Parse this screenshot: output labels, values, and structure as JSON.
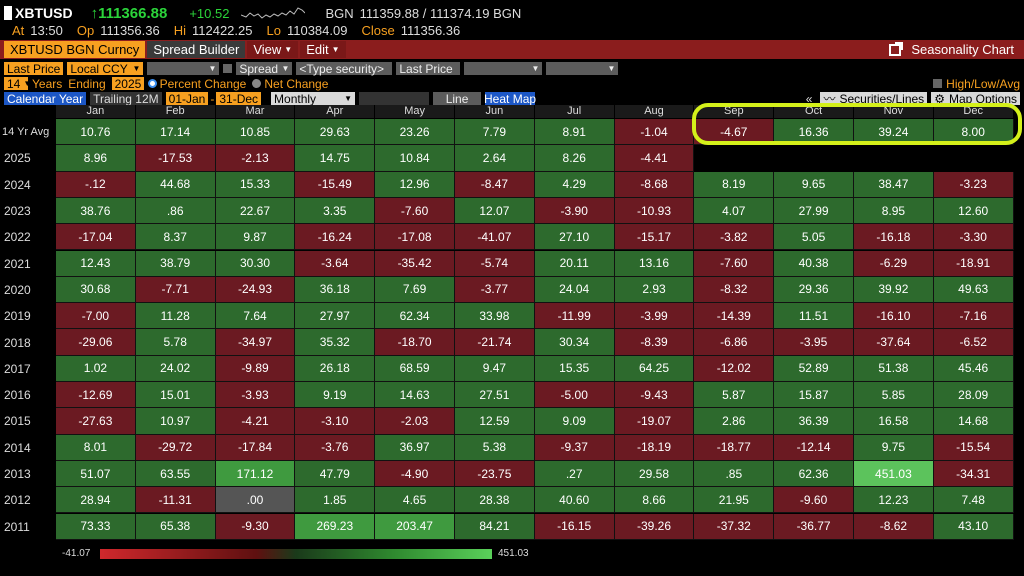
{
  "ticker": {
    "symbol": "XBTUSD",
    "last": "↑111366.88",
    "change": "+10.52",
    "bgn_label": "BGN",
    "bgn_value": "111359.88 / 111374.19 BGN",
    "at_label": "At",
    "at_value": "13:50",
    "op_label": "Op",
    "op_value": "111356.36",
    "hi_label": "Hi",
    "hi_value": "112422.25",
    "lo_label": "Lo",
    "lo_value": "110384.09",
    "close_label": "Close",
    "close_value": "111356.36"
  },
  "menubar": {
    "security": "XBTUSD BGN Curncy",
    "spread_builder": "Spread Builder",
    "view": "View",
    "edit": "Edit",
    "right_title": "Seasonality Chart"
  },
  "controls": {
    "field": "Last Price",
    "currency": "Local CCY",
    "spread": "Spread",
    "type_security_placeholder": "<Type security>",
    "field2": "Last Price",
    "years": "14",
    "years_label": "Years",
    "ending_label": "Ending",
    "ending_year": "2025",
    "percent_change": "Percent Change",
    "net_change": "Net Change",
    "high_low_avg": "High/Low/Avg",
    "calendar_year": "Calendar Year",
    "trailing": "Trailing 12M",
    "from_date": "01-Jan",
    "dash": "-",
    "to_date": "31-Dec",
    "periodicity": "Monthly",
    "line": "Line",
    "heat_map": "Heat Map",
    "collapse": "«",
    "securities_lines": "Securities/Lines",
    "map_options": "Map Options"
  },
  "table": {
    "months": [
      "Jan",
      "Feb",
      "Mar",
      "Apr",
      "May",
      "Jun",
      "Jul",
      "Aug",
      "Sep",
      "Oct",
      "Nov",
      "Dec"
    ],
    "rows": [
      {
        "label": "14 Yr Avg",
        "values": [
          "10.76",
          "17.14",
          "10.85",
          "29.63",
          "23.26",
          "7.79",
          "8.91",
          "-1.04",
          "-4.67",
          "16.36",
          "39.24",
          "8.00"
        ]
      },
      {
        "label": "2025",
        "values": [
          "8.96",
          "-17.53",
          "-2.13",
          "14.75",
          "10.84",
          "2.64",
          "8.26",
          "-4.41",
          "",
          "",
          "",
          ""
        ]
      },
      {
        "label": "2024",
        "values": [
          "-.12",
          "44.68",
          "15.33",
          "-15.49",
          "12.96",
          "-8.47",
          "4.29",
          "-8.68",
          "8.19",
          "9.65",
          "38.47",
          "-3.23"
        ]
      },
      {
        "label": "2023",
        "values": [
          "38.76",
          ".86",
          "22.67",
          "3.35",
          "-7.60",
          "12.07",
          "-3.90",
          "-10.93",
          "4.07",
          "27.99",
          "8.95",
          "12.60"
        ]
      },
      {
        "label": "2022",
        "values": [
          "-17.04",
          "8.37",
          "9.87",
          "-16.24",
          "-17.08",
          "-41.07",
          "27.10",
          "-15.17",
          "-3.82",
          "5.05",
          "-16.18",
          "-3.30"
        ]
      },
      {
        "label": "2021",
        "values": [
          "12.43",
          "38.79",
          "30.30",
          "-3.64",
          "-35.42",
          "-5.74",
          "20.11",
          "13.16",
          "-7.60",
          "40.38",
          "-6.29",
          "-18.91"
        ]
      },
      {
        "label": "2020",
        "values": [
          "30.68",
          "-7.71",
          "-24.93",
          "36.18",
          "7.69",
          "-3.77",
          "24.04",
          "2.93",
          "-8.32",
          "29.36",
          "39.92",
          "49.63"
        ]
      },
      {
        "label": "2019",
        "values": [
          "-7.00",
          "11.28",
          "7.64",
          "27.97",
          "62.34",
          "33.98",
          "-11.99",
          "-3.99",
          "-14.39",
          "11.51",
          "-16.10",
          "-7.16"
        ]
      },
      {
        "label": "2018",
        "values": [
          "-29.06",
          "5.78",
          "-34.97",
          "35.32",
          "-18.70",
          "-21.74",
          "30.34",
          "-8.39",
          "-6.86",
          "-3.95",
          "-37.64",
          "-6.52"
        ]
      },
      {
        "label": "2017",
        "values": [
          "1.02",
          "24.02",
          "-9.89",
          "26.18",
          "68.59",
          "9.47",
          "15.35",
          "64.25",
          "-12.02",
          "52.89",
          "51.38",
          "45.46"
        ]
      },
      {
        "label": "2016",
        "values": [
          "-12.69",
          "15.01",
          "-3.93",
          "9.19",
          "14.63",
          "27.51",
          "-5.00",
          "-9.43",
          "5.87",
          "15.87",
          "5.85",
          "28.09"
        ]
      },
      {
        "label": "2015",
        "values": [
          "-27.63",
          "10.97",
          "-4.21",
          "-3.10",
          "-2.03",
          "12.59",
          "9.09",
          "-19.07",
          "2.86",
          "36.39",
          "16.58",
          "14.68"
        ]
      },
      {
        "label": "2014",
        "values": [
          "8.01",
          "-29.72",
          "-17.84",
          "-3.76",
          "36.97",
          "5.38",
          "-9.37",
          "-18.19",
          "-18.77",
          "-12.14",
          "9.75",
          "-15.54"
        ]
      },
      {
        "label": "2013",
        "values": [
          "51.07",
          "63.55",
          "171.12",
          "47.79",
          "-4.90",
          "-23.75",
          ".27",
          "29.58",
          ".85",
          "62.36",
          "451.03",
          "-34.31"
        ]
      },
      {
        "label": "2012",
        "values": [
          "28.94",
          "-11.31",
          ".00",
          "1.85",
          "4.65",
          "28.38",
          "40.60",
          "8.66",
          "21.95",
          "-9.60",
          "12.23",
          "7.48"
        ]
      },
      {
        "label": "2011",
        "values": [
          "73.33",
          "65.38",
          "-9.30",
          "269.23",
          "203.47",
          "84.21",
          "-16.15",
          "-39.26",
          "-37.32",
          "-36.77",
          "-8.62",
          "43.10"
        ]
      }
    ]
  },
  "legend": {
    "min": "-41.07",
    "max": "451.03"
  },
  "colors": {
    "positive": "#2d6a2d",
    "negative": "#6b1a22",
    "highlight": "#d4f01a",
    "accent": "#f7a020"
  }
}
